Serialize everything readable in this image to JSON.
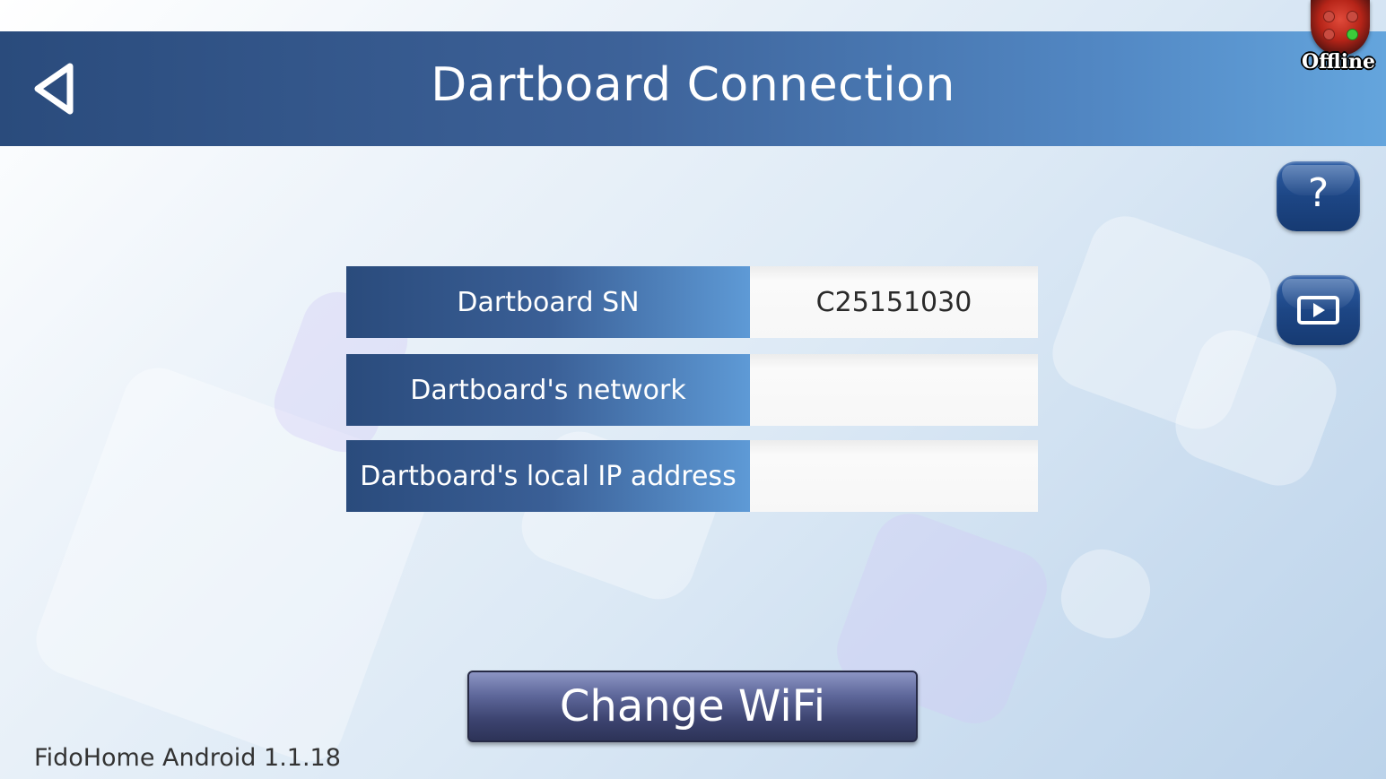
{
  "header": {
    "title": "Dartboard Connection",
    "back_icon": "back-triangle-icon"
  },
  "status": {
    "label": "Offline",
    "icon": "dartboard-status-icon"
  },
  "side_buttons": {
    "help_icon": "question-mark-icon",
    "help_glyph": "?",
    "video_icon": "video-play-icon"
  },
  "info_rows": [
    {
      "label": "Dartboard SN",
      "value": "C25151030"
    },
    {
      "label": "Dartboard's network",
      "value": ""
    },
    {
      "label": "Dartboard's local IP address",
      "value": ""
    }
  ],
  "actions": {
    "change_wifi_label": "Change WiFi"
  },
  "footer": {
    "version": "FidoHome Android 1.1.18"
  },
  "colors": {
    "header_dark": "#2a4b7c",
    "header_light": "#64a5dd",
    "button_dark": "#2d3358",
    "status_red": "#b52418",
    "status_green": "#3ccc3a"
  }
}
